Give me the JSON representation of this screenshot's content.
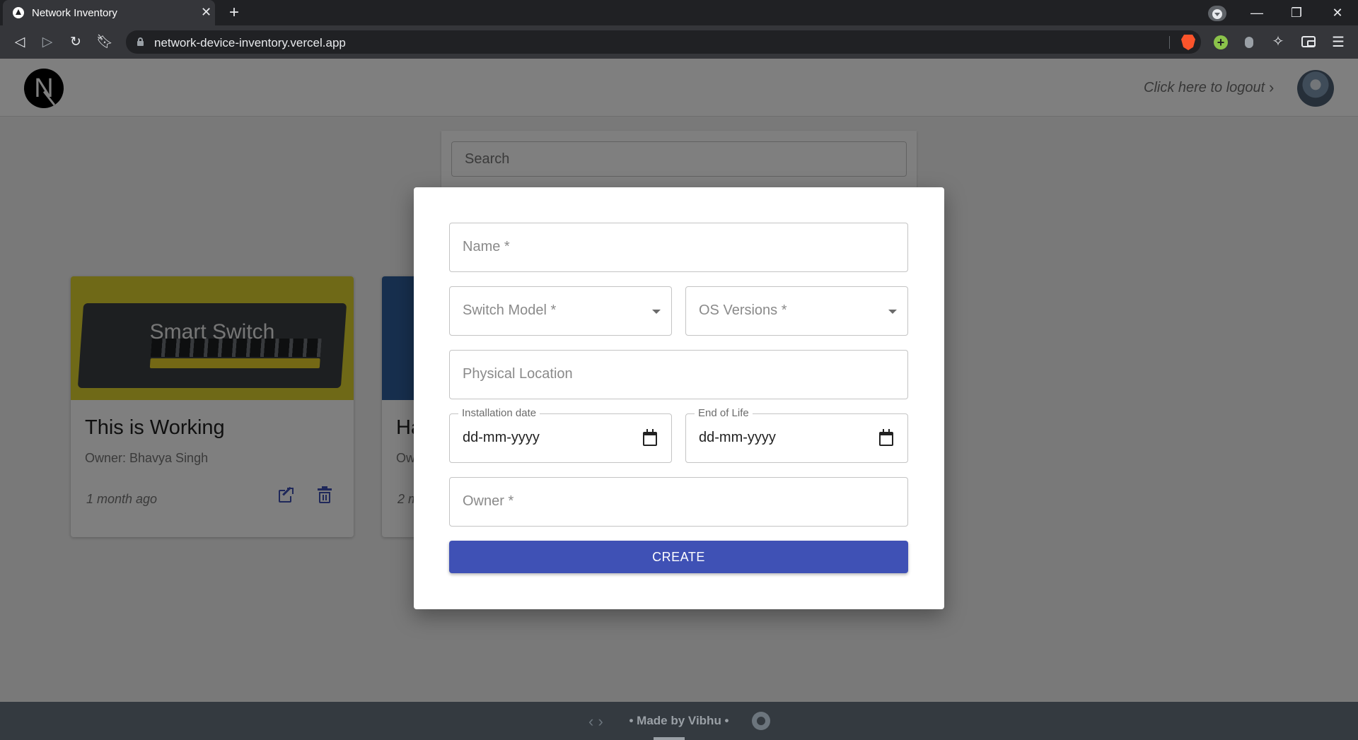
{
  "browser": {
    "tab_title": "Network Inventory",
    "tab_close": "✕",
    "new_tab": "+",
    "url": "network-device-inventory.vercel.app",
    "window_controls": {
      "minimize": "—",
      "restore": "❐",
      "close": "✕"
    }
  },
  "header": {
    "logo_letter": "N",
    "logout_text": "Click here to logout",
    "logout_chevron": "›"
  },
  "search": {
    "placeholder": "Search"
  },
  "cards": [
    {
      "image_text": "Smart Switch",
      "title": "This is Working",
      "owner": "Owner: Bhavya Singh",
      "time": "1 month ago"
    },
    {
      "title": "Ha",
      "owner": "Ow",
      "time": "2 m"
    }
  ],
  "modal": {
    "name_label": "Name *",
    "switch_model_label": "Switch Model *",
    "os_versions_label": "OS Versions *",
    "physical_location_label": "Physical Location",
    "installation_date_label": "Installation date",
    "installation_date_value": "dd-mm-yyyy",
    "end_of_life_label": "End of Life",
    "end_of_life_value": "dd-mm-yyyy",
    "owner_label": "Owner *",
    "create_button": "CREATE"
  },
  "footer": {
    "code_symbol": "‹ ›",
    "text": "• Made by Vibhu •"
  },
  "colors": {
    "primary": "#3f51b5",
    "footer_bg": "#343a40",
    "card1_media": "#ded22f",
    "card2_media": "#2f5f9c"
  },
  "icons": [
    "lock-icon",
    "brave-icon",
    "puzzle-icon",
    "wallet-icon",
    "menu-icon",
    "open-in-new-icon",
    "delete-icon",
    "calendar-icon",
    "dropdown-caret-icon",
    "github-icon"
  ]
}
